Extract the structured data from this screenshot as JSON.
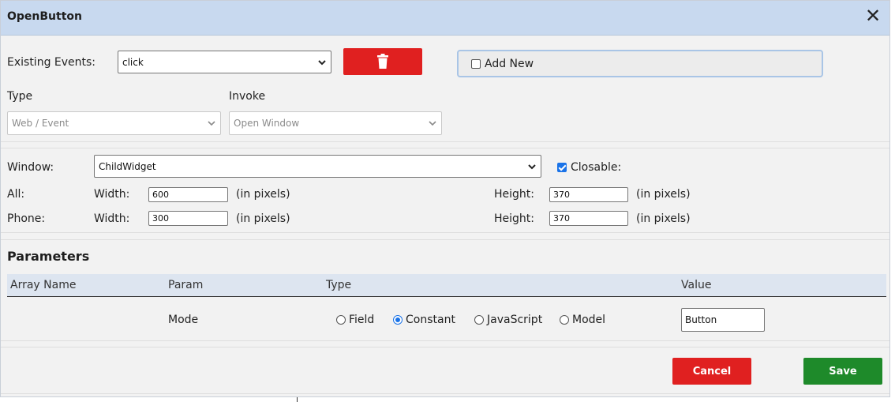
{
  "dialog": {
    "title": "OpenButton",
    "close_symbol": "✕"
  },
  "events": {
    "label": "Existing Events:",
    "selected": "click",
    "add_new_label": "Add New",
    "add_new_checked": false
  },
  "type": {
    "label": "Type",
    "selected": "Web / Event"
  },
  "invoke": {
    "label": "Invoke",
    "selected": "Open Window"
  },
  "window": {
    "label": "Window:",
    "selected": "ChildWidget",
    "closable_label": "Closable:",
    "closable_checked": true
  },
  "sizes": {
    "all": {
      "label": "All:",
      "width_label": "Width:",
      "width": "600",
      "height_label": "Height:",
      "height": "370",
      "unit": "(in pixels)"
    },
    "phone": {
      "label": "Phone:",
      "width_label": "Width:",
      "width": "300",
      "height_label": "Height:",
      "height": "370",
      "unit": "(in pixels)"
    }
  },
  "parameters": {
    "title": "Parameters",
    "columns": [
      "Array Name",
      "Param",
      "Type",
      "Value"
    ],
    "rows": [
      {
        "array_name": "",
        "param": "Mode",
        "type_options": [
          "Field",
          "Constant",
          "JavaScript",
          "Model"
        ],
        "selected_type": "Constant",
        "value": "Button"
      }
    ]
  },
  "footer": {
    "cancel_label": "Cancel",
    "save_label": "Save"
  },
  "colors": {
    "title_bar": "#c8d9ef",
    "danger": "#e02020",
    "success": "#1e8a2a",
    "accent": "#1a73e8"
  }
}
